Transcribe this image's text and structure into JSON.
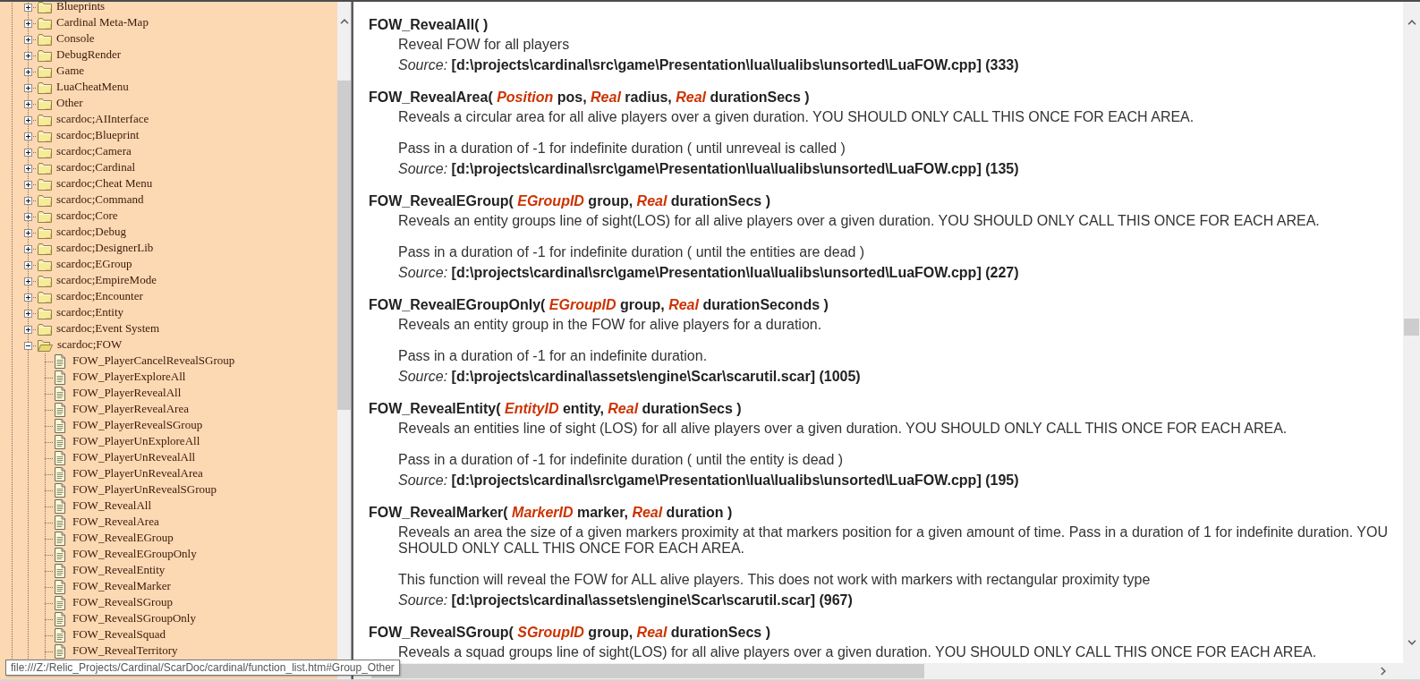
{
  "sidebar": {
    "tree": [
      {
        "label": "Blueprints",
        "expanded": false
      },
      {
        "label": "Cardinal Meta-Map",
        "expanded": false
      },
      {
        "label": "Console",
        "expanded": false
      },
      {
        "label": "DebugRender",
        "expanded": false
      },
      {
        "label": "Game",
        "expanded": false
      },
      {
        "label": "LuaCheatMenu",
        "expanded": false
      },
      {
        "label": "Other",
        "expanded": false
      },
      {
        "label": "scardoc;AIInterface",
        "expanded": false
      },
      {
        "label": "scardoc;Blueprint",
        "expanded": false
      },
      {
        "label": "scardoc;Camera",
        "expanded": false
      },
      {
        "label": "scardoc;Cardinal",
        "expanded": false
      },
      {
        "label": "scardoc;Cheat Menu",
        "expanded": false
      },
      {
        "label": "scardoc;Command",
        "expanded": false
      },
      {
        "label": "scardoc;Core",
        "expanded": false
      },
      {
        "label": "scardoc;Debug",
        "expanded": false
      },
      {
        "label": "scardoc;DesignerLib",
        "expanded": false
      },
      {
        "label": "scardoc;EGroup",
        "expanded": false
      },
      {
        "label": "scardoc;EmpireMode",
        "expanded": false
      },
      {
        "label": "scardoc;Encounter",
        "expanded": false
      },
      {
        "label": "scardoc;Entity",
        "expanded": false
      },
      {
        "label": "scardoc;Event System",
        "expanded": false
      },
      {
        "label": "scardoc;FOW",
        "expanded": true,
        "children": [
          {
            "label": "FOW_PlayerCancelRevealSGroup"
          },
          {
            "label": "FOW_PlayerExploreAll"
          },
          {
            "label": "FOW_PlayerRevealAll"
          },
          {
            "label": "FOW_PlayerRevealArea"
          },
          {
            "label": "FOW_PlayerRevealSGroup"
          },
          {
            "label": "FOW_PlayerUnExploreAll"
          },
          {
            "label": "FOW_PlayerUnRevealAll"
          },
          {
            "label": "FOW_PlayerUnRevealArea"
          },
          {
            "label": "FOW_PlayerUnRevealSGroup"
          },
          {
            "label": "FOW_RevealAll"
          },
          {
            "label": "FOW_RevealArea"
          },
          {
            "label": "FOW_RevealEGroup"
          },
          {
            "label": "FOW_RevealEGroupOnly"
          },
          {
            "label": "FOW_RevealEntity"
          },
          {
            "label": "FOW_RevealMarker"
          },
          {
            "label": "FOW_RevealSGroup"
          },
          {
            "label": "FOW_RevealSGroupOnly"
          },
          {
            "label": "FOW_RevealSquad"
          },
          {
            "label": "FOW_RevealTerritory"
          }
        ]
      }
    ]
  },
  "content": {
    "functions": [
      {
        "signature": "FOW_RevealAll( )",
        "paragraphs": [
          "Reveal FOW for all players"
        ],
        "source": "*Source:* **[d:\\projects\\cardinal\\src\\game\\Presentation\\lua\\lualibs\\unsorted\\LuaFOW.cpp] (333)**"
      },
      {
        "signature": "FOW_RevealArea( *Position* pos, *Real* radius, *Real* durationSecs )",
        "paragraphs": [
          "Reveals a circular area for all alive players over a given duration. YOU SHOULD ONLY CALL THIS ONCE FOR EACH AREA.",
          "Pass in a duration of -1 for indefinite duration ( until unreveal is called )"
        ],
        "source": "*Source:* **[d:\\projects\\cardinal\\src\\game\\Presentation\\lua\\lualibs\\unsorted\\LuaFOW.cpp] (135)**"
      },
      {
        "signature": "FOW_RevealEGroup( *EGroupID* group, *Real* durationSecs )",
        "paragraphs": [
          "Reveals an entity groups line of sight(LOS) for all alive players over a given duration. YOU SHOULD ONLY CALL THIS ONCE FOR EACH AREA.",
          "Pass in a duration of -1 for indefinite duration ( until the entities are dead )"
        ],
        "source": "*Source:* **[d:\\projects\\cardinal\\src\\game\\Presentation\\lua\\lualibs\\unsorted\\LuaFOW.cpp] (227)**"
      },
      {
        "signature": "FOW_RevealEGroupOnly( *EGroupID* group, *Real* durationSeconds )",
        "paragraphs": [
          "Reveals an entity group in the FOW for alive players for a duration.",
          "Pass in a duration of -1 for an indefinite duration."
        ],
        "source": "*Source:* **[d:\\projects\\cardinal\\assets\\engine\\Scar\\scarutil.scar] (1005)**"
      },
      {
        "signature": "FOW_RevealEntity( *EntityID* entity, *Real* durationSecs )",
        "paragraphs": [
          "Reveals an entities line of sight (LOS) for all alive players over a given duration. YOU SHOULD ONLY CALL THIS ONCE FOR EACH AREA.",
          "Pass in a duration of -1 for indefinite duration ( until the entity is dead )"
        ],
        "source": "*Source:* **[d:\\projects\\cardinal\\src\\game\\Presentation\\lua\\lualibs\\unsorted\\LuaFOW.cpp] (195)**"
      },
      {
        "signature": "FOW_RevealMarker( *MarkerID* marker, *Real* duration )",
        "paragraphs": [
          "Reveals an area the size of a given markers proximity at that markers position for a given amount of time. Pass in a duration of 1 for indefinite duration. YOU SHOULD ONLY CALL THIS ONCE FOR EACH AREA.",
          "This function will reveal the FOW for ALL alive players. This does not work with markers with rectangular proximity type"
        ],
        "source": "*Source:* **[d:\\projects\\cardinal\\assets\\engine\\Scar\\scarutil.scar] (967)**"
      },
      {
        "signature": "FOW_RevealSGroup( *SGroupID* group, *Real* durationSecs )",
        "paragraphs": [
          "Reveals a squad groups line of sight(LOS) for all alive players over a given duration. YOU SHOULD ONLY CALL THIS ONCE FOR EACH AREA."
        ]
      }
    ]
  },
  "tooltip": {
    "text": "file:///Z:/Relic_Projects/Cardinal/ScarDoc/cardinal/function_list.htm#Group_Other"
  }
}
